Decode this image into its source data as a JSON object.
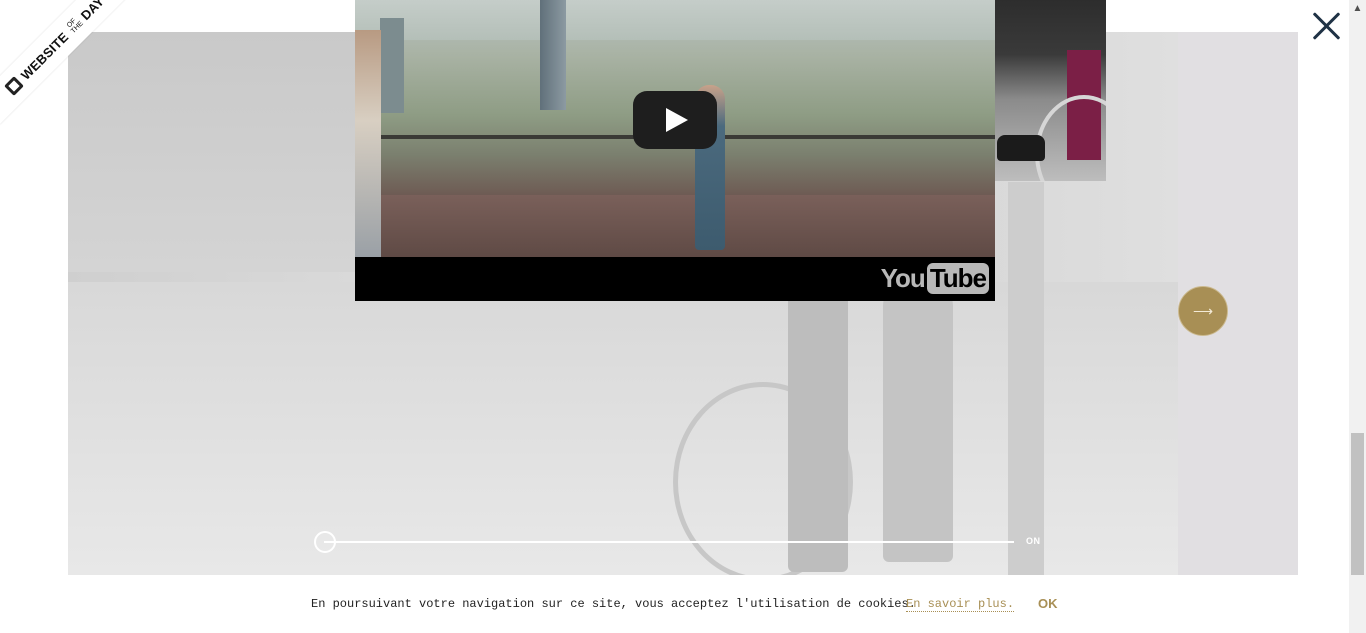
{
  "ribbon": {
    "word1": "WEBSITE",
    "word2": "OF THE",
    "word3": "DAY"
  },
  "video": {
    "play_icon": "play-icon",
    "brand_you": "You",
    "brand_tube": "Tube"
  },
  "navigation": {
    "close_icon": "close-icon",
    "next_icon": "arrow-right-icon",
    "next_glyph": "⟶"
  },
  "slider": {
    "label": "ON",
    "position": 0
  },
  "scrollbar": {
    "up_glyph": "▲"
  },
  "cookie_bar": {
    "message": "En poursuivant votre navigation sur ce site, vous acceptez l'utilisation de cookies.",
    "learn_more": "En savoir plus.",
    "ok": "OK"
  },
  "colors": {
    "accent": "#a88f55",
    "close": "#1f3245"
  }
}
